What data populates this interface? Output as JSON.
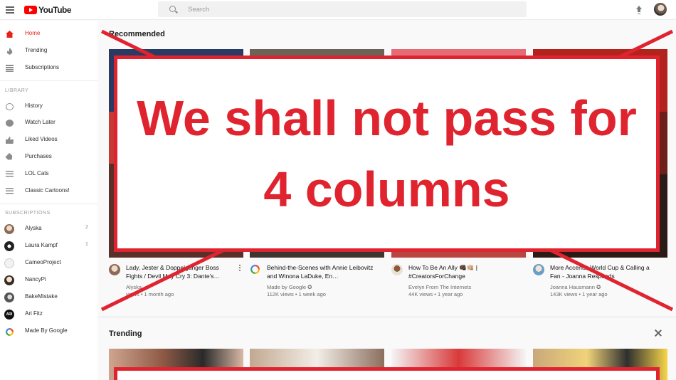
{
  "app": {
    "logo_text": "YouTube"
  },
  "search": {
    "placeholder": "Search"
  },
  "sidebar": {
    "main_items": [
      {
        "label": "Home",
        "icon": "home-icon",
        "active": true
      },
      {
        "label": "Trending",
        "icon": "flame-icon"
      },
      {
        "label": "Subscriptions",
        "icon": "subscriptions-icon"
      }
    ],
    "library_label": "LIBRARY",
    "library_items": [
      {
        "label": "History",
        "icon": "history-icon"
      },
      {
        "label": "Watch Later",
        "icon": "clock-icon"
      },
      {
        "label": "Liked Videos",
        "icon": "thumbs-up-icon"
      },
      {
        "label": "Purchases",
        "icon": "tag-icon"
      },
      {
        "label": "LOL Cats",
        "icon": "playlist-icon"
      },
      {
        "label": "Classic Cartoons!",
        "icon": "playlist-icon"
      }
    ],
    "subscriptions_label": "SUBSCRIPTIONS",
    "subscriptions": [
      {
        "label": "Alyska",
        "count": "2"
      },
      {
        "label": "Laura Kampf",
        "count": "1"
      },
      {
        "label": "CameoProject"
      },
      {
        "label": "NancyPi"
      },
      {
        "label": "BakeMistake"
      },
      {
        "label": "Ari Fitz",
        "avatar_text": "ARI"
      },
      {
        "label": "Made By Google"
      }
    ]
  },
  "recommended": {
    "title": "Recommended",
    "videos": [
      {
        "title": "Lady, Jester & Doppelganger Boss Fights / Devil May Cry 3: Dante's…",
        "channel": "Alyska",
        "meta": "views • 1 month ago"
      },
      {
        "title": "Behind-the-Scenes with Annie Leibovitz and Winona LaDuke, En…",
        "channel": "Made by Google ✪",
        "meta": "112K views • 1 week ago"
      },
      {
        "title": "How To Be An Ally 👊🏿👊🏼 | #CreatorsForChange",
        "channel": "Evelyn From The Internets",
        "meta": "44K views • 1 year ago"
      },
      {
        "title": "More Accents, World Cup & Calling a Fan - Joanna Responds",
        "channel": "Joanna Hausmann ✪",
        "meta": "143K views • 1 year ago"
      }
    ]
  },
  "trending": {
    "title": "Trending"
  },
  "overlay": {
    "text": "We shall not pass for 4 columns",
    "color": "#e0242f"
  },
  "colors": {
    "accent": "#e62117",
    "brand_red": "#ff0000"
  }
}
